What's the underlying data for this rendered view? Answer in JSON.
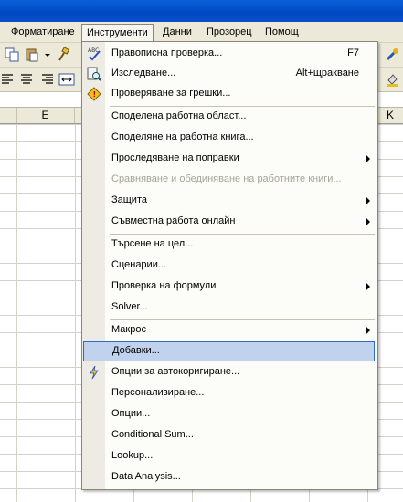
{
  "menubar": {
    "items": [
      "Форматиране",
      "Инструменти",
      "Данни",
      "Прозорец",
      "Помощ"
    ]
  },
  "columns": [
    "E",
    "K"
  ],
  "tools_menu": {
    "items": [
      {
        "label": "Правописна проверка...",
        "shortcut": "F7",
        "icon": "spellcheck-icon"
      },
      {
        "label": "Изследване...",
        "shortcut": "Alt+щракване",
        "icon": "research-icon"
      },
      {
        "label": "Проверяване за грешки...",
        "icon": "error-check-icon"
      },
      {
        "label": "Споделена работна област..."
      },
      {
        "label": "Споделяне на работна книга..."
      },
      {
        "label": "Проследяване на поправки",
        "submenu": true
      },
      {
        "label": "Сравняване и обединяване на работните книги...",
        "disabled": true
      },
      {
        "label": "Защита",
        "submenu": true
      },
      {
        "label": "Съвместна работа онлайн",
        "submenu": true
      },
      {
        "label": "Търсене на цел..."
      },
      {
        "label": "Сценарии..."
      },
      {
        "label": "Проверка на формули",
        "submenu": true
      },
      {
        "label": "Solver..."
      },
      {
        "label": "Макрос",
        "submenu": true
      },
      {
        "label": "Добавки...",
        "highlighted": true
      },
      {
        "label": "Опции за автокоригиране...",
        "icon": "autocorrect-icon"
      },
      {
        "label": "Персонализиране..."
      },
      {
        "label": "Опции..."
      },
      {
        "label": "Conditional Sum..."
      },
      {
        "label": "Lookup..."
      },
      {
        "label": "Data Analysis..."
      }
    ]
  },
  "colors": {
    "highlight_bg": "#c1d2ee",
    "highlight_border": "#316ac5",
    "menubar_bg": "#ece9d8",
    "title_blue": "#0049c2"
  }
}
